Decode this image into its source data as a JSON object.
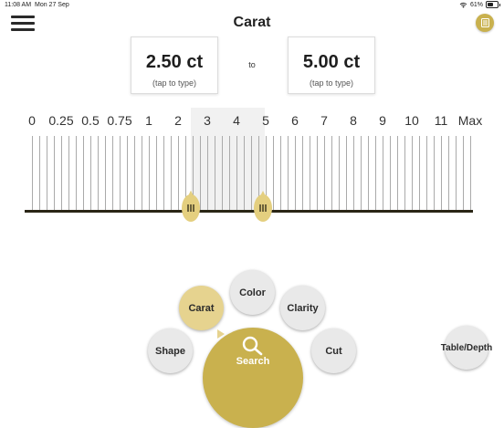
{
  "status_bar": {
    "time": "11:08 AM",
    "date": "Mon 27 Sep",
    "battery": "61%",
    "battery_level": 0.61
  },
  "header": {
    "title": "Carat",
    "menu_icon": "hamburger-menu-icon",
    "doc_icon": "document-icon"
  },
  "range": {
    "min_value": "2.50 ct",
    "max_value": "5.00 ct",
    "min_hint": "(tap to type)",
    "max_hint": "(tap to type)",
    "separator": "to"
  },
  "scale": {
    "labels": [
      "0",
      "0.25",
      "0.5",
      "0.75",
      "1",
      "2",
      "3",
      "4",
      "5",
      "6",
      "7",
      "8",
      "9",
      "10",
      "11",
      "Max"
    ],
    "selected_from": "2.50",
    "selected_to": "5.00"
  },
  "nav": {
    "carat": "Carat",
    "color": "Color",
    "clarity": "Clarity",
    "shape": "Shape",
    "cut": "Cut",
    "search": "Search",
    "table_depth": "Table/Depth"
  },
  "colors": {
    "accent": "#c9b14e",
    "accent_light": "#e6d38f",
    "baseline": "#2a2616"
  }
}
